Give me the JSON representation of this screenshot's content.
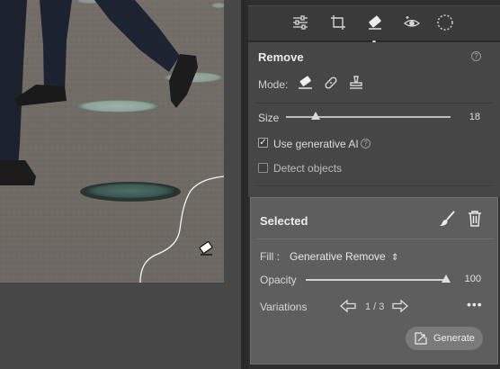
{
  "toolbar": {
    "tools": [
      {
        "icon": "sliders-icon"
      },
      {
        "icon": "crop-icon"
      },
      {
        "icon": "eraser-icon",
        "active": true
      },
      {
        "icon": "red-eye-icon"
      },
      {
        "icon": "masking-icon"
      }
    ]
  },
  "remove": {
    "title": "Remove",
    "help": "?",
    "mode_label": "Mode:",
    "modes": [
      "remove-mode-icon",
      "heal-mode-icon",
      "clone-mode-icon"
    ],
    "size": {
      "label": "Size",
      "value": "18",
      "fraction": 0.18
    },
    "use_generative_ai": {
      "label": "Use generative AI",
      "checked": true,
      "help": "?"
    },
    "detect_objects": {
      "label": "Detect objects",
      "checked": false
    }
  },
  "selected": {
    "title": "Selected",
    "fill_label": "Fill :",
    "fill_value": "Generative Remove",
    "fill_caret": "⇕",
    "opacity": {
      "label": "Opacity",
      "value": "100",
      "fraction": 1.0
    },
    "variations": {
      "label": "Variations",
      "current": "1 / 3"
    },
    "more": "•••",
    "generate_label": "Generate"
  },
  "colors": {
    "panel_bg": "#2e2e2e",
    "section_bg": "#464646",
    "selected_bg": "#5e5e5e",
    "text": "#e2e2e2"
  }
}
